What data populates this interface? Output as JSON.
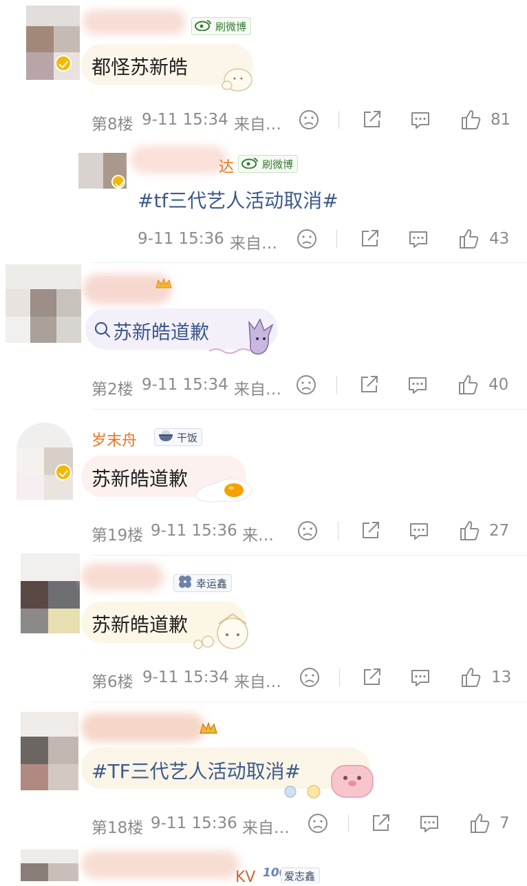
{
  "comments": [
    {
      "text": "都怪苏新皓",
      "badge": "刷微博",
      "floor": "第8楼",
      "time": "9-11 15:34",
      "source": "来自…",
      "likes": "81"
    },
    {
      "text": "#tf三代艺人活动取消#",
      "badge": "刷微博",
      "name_tail": "达",
      "floor": "",
      "time": "9-11 15:36",
      "source": "来自…",
      "likes": "43"
    },
    {
      "text": "苏新皓道歉",
      "floor": "第2楼",
      "time": "9-11 15:34",
      "source": "来自…",
      "likes": "40"
    },
    {
      "text": "苏新皓道歉",
      "name": "岁末舟",
      "badge": "干饭",
      "floor": "第19楼",
      "time": "9-11 15:36",
      "source": "来…",
      "likes": "27"
    },
    {
      "text": "苏新皓道歉",
      "badge": "幸运鑫",
      "floor": "第6楼",
      "time": "9-11 15:34",
      "source": "来自…",
      "likes": "13"
    },
    {
      "text": "#TF三代艺人活动取消#",
      "floor": "第18楼",
      "time": "9-11 15:36",
      "source": "来自…",
      "likes": "7"
    },
    {
      "name_tail": "KV",
      "badge_num": "100",
      "badge": "爱志鑫"
    }
  ],
  "colors": {
    "topic": "#3c5a8c",
    "meta": "#8a8a8a",
    "name": "#e8741c",
    "verified": "#f5b800"
  },
  "icons": [
    "dislike-icon",
    "share-icon",
    "comment-icon",
    "like-icon",
    "search-icon",
    "weibo-icon",
    "rice-bowl-icon",
    "clover-icon"
  ]
}
